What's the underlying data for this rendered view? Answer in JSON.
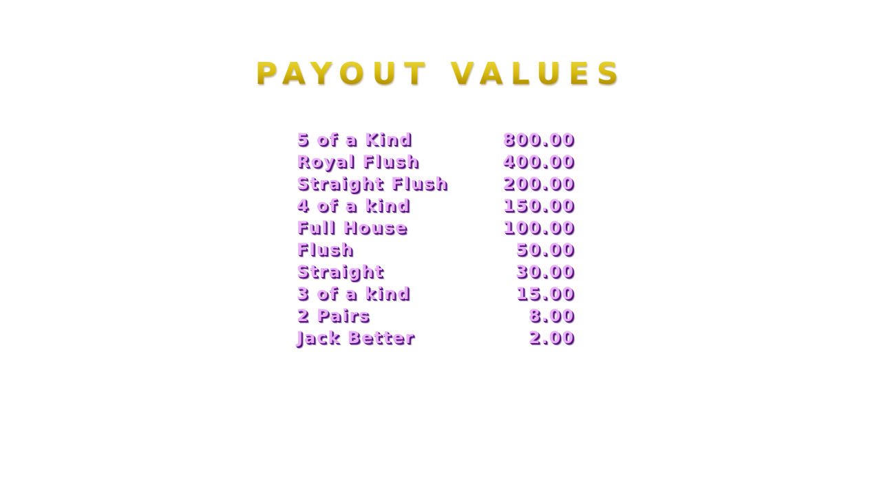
{
  "title": "PAYOUT VALUES",
  "payouts": [
    {
      "hand": "5 of a Kind",
      "value": "800.00"
    },
    {
      "hand": "Royal Flush",
      "value": "400.00"
    },
    {
      "hand": "Straight Flush",
      "value": "200.00"
    },
    {
      "hand": "4 of a kind",
      "value": "150.00"
    },
    {
      "hand": "Full House",
      "value": "100.00"
    },
    {
      "hand": "Flush",
      "value": "50.00"
    },
    {
      "hand": "Straight",
      "value": "30.00"
    },
    {
      "hand": "3 of a kind",
      "value": "15.00"
    },
    {
      "hand": "2 Pairs",
      "value": "8.00"
    },
    {
      "hand": "Jack Better",
      "value": "2.00"
    }
  ],
  "colors": {
    "title_gold": "#d9bd10",
    "row_text": "#e7b0f7",
    "row_shadow": "#4a0a72"
  }
}
